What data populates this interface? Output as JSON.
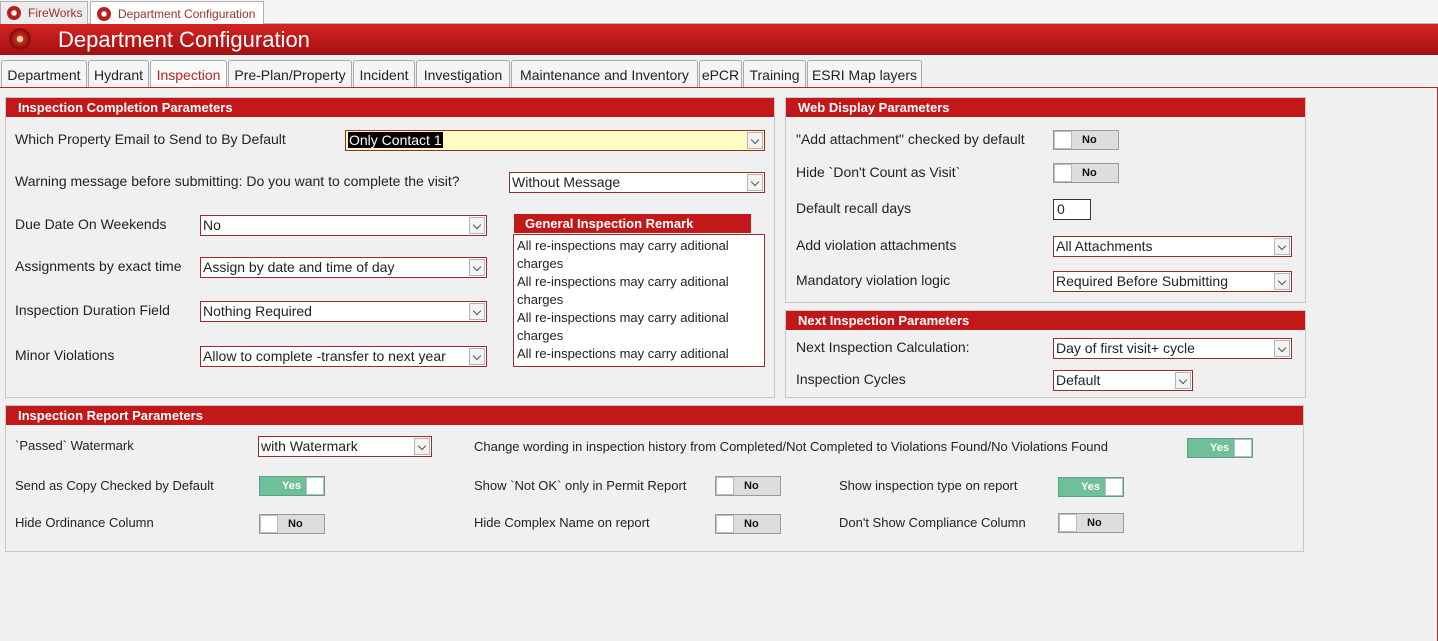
{
  "doc_tabs": [
    "FireWorks",
    "Department Configuration"
  ],
  "header": {
    "title": "Department Configuration"
  },
  "main_tabs": [
    "Department",
    "Hydrant",
    "Inspection",
    "Pre-Plan/Property",
    "Incident",
    "Investigation",
    "Maintenance and Inventory",
    "ePCR",
    "Training",
    "ESRI Map layers"
  ],
  "completion": {
    "title": "Inspection Completion Parameters",
    "email_label": "Which Property Email to Send to By Default",
    "email_value": "Only Contact 1",
    "warning_label": "Warning message before submitting: Do you want to complete the visit?",
    "warning_value": "Without Message",
    "weekend_label": "Due Date On Weekends",
    "weekend_value": "No",
    "assign_label": "Assignments by exact time",
    "assign_value": "Assign by date and time of day",
    "duration_label": "Inspection Duration Field",
    "duration_value": "Nothing Required",
    "minor_label": "Minor Violations",
    "minor_value": "Allow to complete -transfer to next year",
    "remark_title": "General Inspection Remark",
    "remark_lines": [
      "All re-inspections may carry aditional",
      "charges",
      "All re-inspections may carry aditional",
      "charges",
      "All re-inspections may carry aditional",
      "charges",
      "All re-inspections may carry aditional"
    ]
  },
  "web": {
    "title": "Web Display Parameters",
    "attach_label": "\"Add attachment\" checked by default",
    "attach_toggle": "No",
    "hide_visit_label": "Hide `Don't Count as Visit`",
    "hide_visit_toggle": "No",
    "recall_label": "Default recall days",
    "recall_value": "0",
    "viol_attach_label": "Add violation attachments",
    "viol_attach_value": "All Attachments",
    "mandatory_label": "Mandatory violation logic",
    "mandatory_value": "Required Before Submitting"
  },
  "next": {
    "title": "Next Inspection Parameters",
    "calc_label": "Next Inspection Calculation:",
    "calc_value": "Day of first visit+ cycle",
    "cycles_label": "Inspection Cycles",
    "cycles_value": "Default"
  },
  "report": {
    "title": "Inspection Report Parameters",
    "watermark_label": "`Passed` Watermark",
    "watermark_value": "with Watermark",
    "wording_label": "Change wording in inspection history from Completed/Not Completed to Violations Found/No Violations Found",
    "wording_toggle": "Yes",
    "copy_label": "Send as Copy Checked by Default",
    "copy_toggle": "Yes",
    "notok_label": "Show `Not OK` only in Permit Report",
    "notok_toggle": "No",
    "type_label": "Show inspection type on report",
    "type_toggle": "Yes",
    "ordinance_label": "Hide Ordinance Column",
    "ordinance_toggle": "No",
    "complex_label": "Hide Complex Name on report",
    "complex_toggle": "No",
    "compliance_label": "Don't Show Compliance Column",
    "compliance_toggle": "No"
  },
  "colors": {
    "accent": "#c2181a",
    "toggle_yes": "#6fbf9b"
  }
}
